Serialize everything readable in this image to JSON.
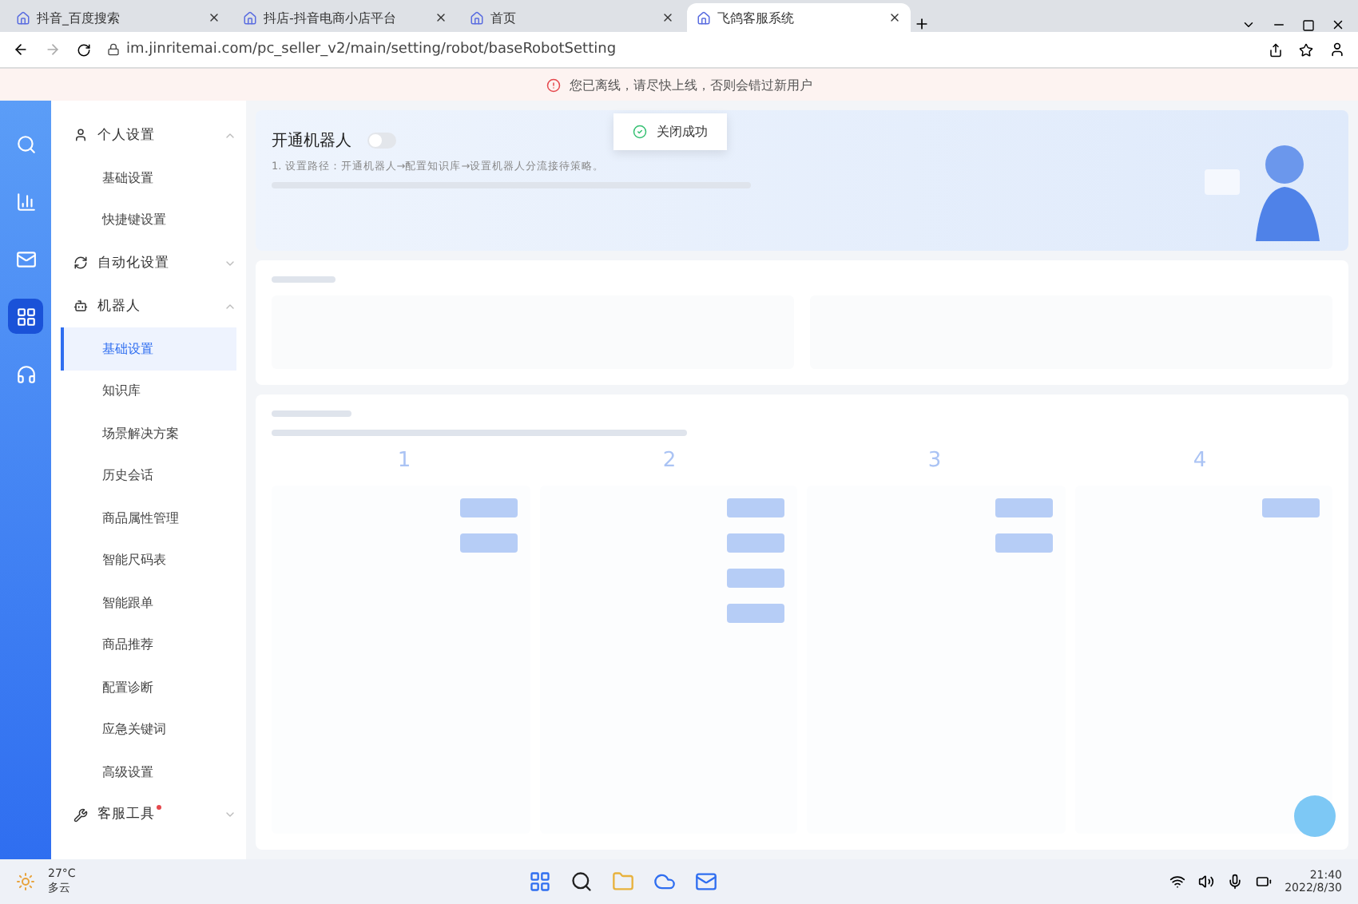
{
  "browser": {
    "tabs": [
      {
        "title": "抖音_百度搜索",
        "selected": false
      },
      {
        "title": "抖店-抖音电商小店平台",
        "selected": false
      },
      {
        "title": "首页",
        "selected": false
      },
      {
        "title": "飞鸽客服系统",
        "selected": true
      }
    ],
    "url": "im.jinritemai.com/pc_seller_v2/main/setting/robot/baseRobotSetting"
  },
  "notice": "您已离线，请尽快上线，否则会错过新用户",
  "toast": "关闭成功",
  "sidebar": {
    "groups": [
      {
        "label": "个人设置",
        "expanded": true,
        "children": [
          {
            "label": "基础设置",
            "selected": false
          },
          {
            "label": "快捷键设置",
            "selected": false
          }
        ]
      },
      {
        "label": "自动化设置",
        "expanded": false
      },
      {
        "label": "机器人",
        "expanded": true,
        "children": [
          {
            "label": "基础设置",
            "selected": true
          },
          {
            "label": "知识库",
            "selected": false
          },
          {
            "label": "场景解决方案",
            "selected": false
          },
          {
            "label": "历史会话",
            "selected": false
          },
          {
            "label": "商品属性管理",
            "selected": false
          },
          {
            "label": "智能尺码表",
            "selected": false
          },
          {
            "label": "智能跟单",
            "selected": false
          },
          {
            "label": "商品推荐",
            "selected": false
          },
          {
            "label": "配置诊断",
            "selected": false
          },
          {
            "label": "应急关键词",
            "selected": false
          },
          {
            "label": "高级设置",
            "selected": false
          }
        ]
      },
      {
        "label": "客服工具",
        "expanded": false,
        "badge": true
      }
    ]
  },
  "robot": {
    "title": "开通机器人",
    "on": false,
    "note": "1. 设置路径：开通机器人→配置知识库→设置机器人分流接待策略。"
  },
  "steps": [
    "1",
    "2",
    "3",
    "4"
  ],
  "taskbar": {
    "temp": "27°C",
    "weather": "多云",
    "time": "21:40",
    "date": "2022/8/30"
  }
}
